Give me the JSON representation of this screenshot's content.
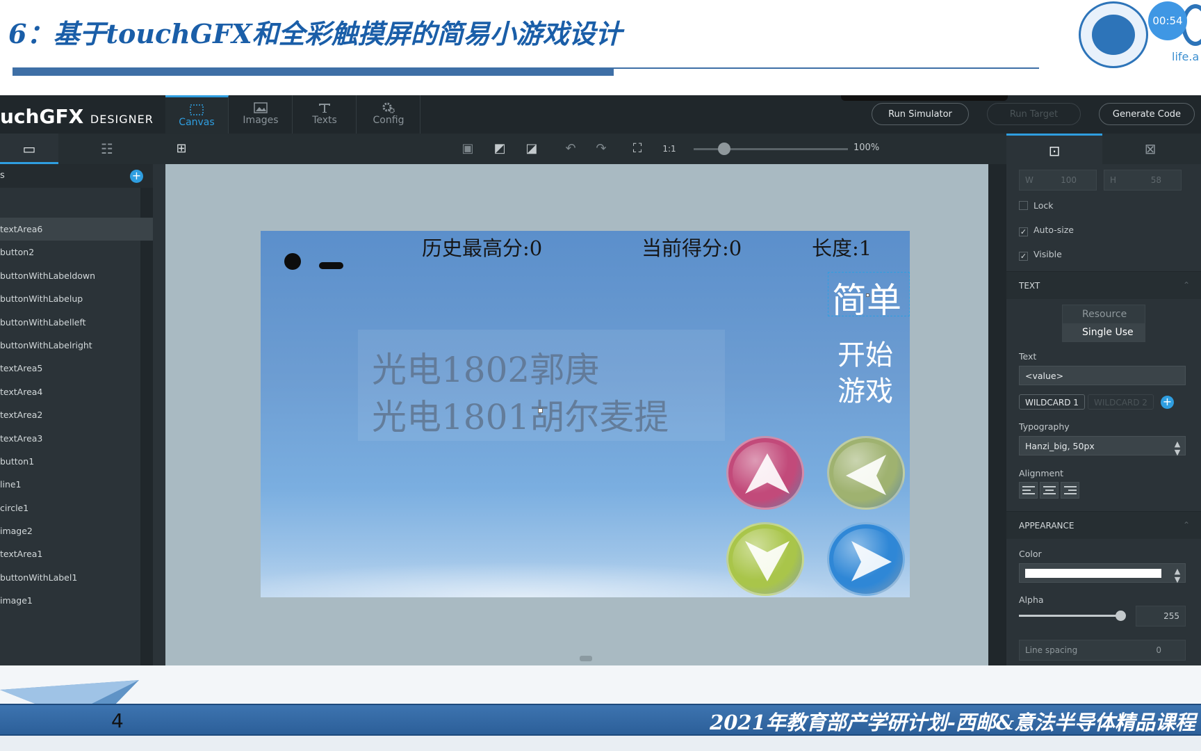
{
  "slide": {
    "title": "6：基于touchGFX和全彩触摸屏的简易小游戏设计",
    "timer": "00:54",
    "logo_text": "life.a",
    "footer": "2021年教育部产学研计划-西邮&意法半导体精品课程",
    "page_number": "4"
  },
  "app": {
    "brand_main": "uchGFX",
    "brand_sub": "DESIGNER",
    "nav_tabs": [
      {
        "label": "Canvas",
        "icon": "canvas-icon"
      },
      {
        "label": "Images",
        "icon": "image-icon"
      },
      {
        "label": "Texts",
        "icon": "text-icon"
      },
      {
        "label": "Config",
        "icon": "gear-icon"
      }
    ],
    "run_simulator": "Run Simulator",
    "run_target": "Run Target",
    "generate_code": "Generate Code",
    "zoom": "100%",
    "zoom_fraction": 0.2
  },
  "layers": {
    "header": "s",
    "items": [
      "textArea6",
      "button2",
      "buttonWithLabeldown",
      "buttonWithLabelup",
      "buttonWithLabelleft",
      "buttonWithLabelright",
      "textArea5",
      "textArea4",
      "textArea2",
      "textArea3",
      "button1",
      "line1",
      "circle1",
      "image2",
      "textArea1",
      "buttonWithLabel1",
      "image1"
    ]
  },
  "game": {
    "high_score": "历史最高分:0",
    "score": "当前得分:0",
    "length": "长度:1",
    "credit_line1": "光电1802郭庚",
    "credit_line2": "光电1801胡尔麦提",
    "difficulty": "简单",
    "start_line1": "开始",
    "start_line2": "游戏",
    "dpad_colors": {
      "up": "#c24a7a",
      "left": "#9fb270",
      "down": "#a9c54a",
      "right": "#2f87d6"
    }
  },
  "inspector": {
    "w_label": "W",
    "w_value": "100",
    "h_label": "H",
    "h_value": "58",
    "lock": "Lock",
    "auto_size": "Auto-size",
    "visible": "Visible",
    "text_section": "TEXT",
    "resource": "Resource",
    "single_use": "Single Use",
    "text_label": "Text",
    "text_value": "<value>",
    "wildcard1": "WILDCARD 1",
    "wildcard2": "WILDCARD 2",
    "typography_label": "Typography",
    "typography_value": "Hanzi_big, 50px",
    "alignment_label": "Alignment",
    "appearance_section": "APPEARANCE",
    "color_label": "Color",
    "color_value": "#ffffff",
    "alpha_label": "Alpha",
    "alpha_value": "255",
    "line_spacing_label": "Line spacing",
    "line_spacing_value": "0"
  }
}
